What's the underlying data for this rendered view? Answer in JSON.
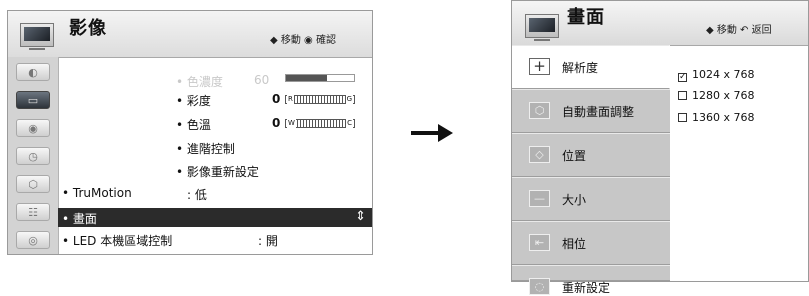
{
  "left_panel": {
    "title": "影像",
    "nav_hint": "◆ 移動 ◉ 確認",
    "sidebar_icons": [
      "picture-icon",
      "screen-icon",
      "audio-icon",
      "time-icon",
      "lock-icon",
      "option-icon",
      "input-icon"
    ],
    "rows": {
      "color_depth": {
        "label": "• 色濃度",
        "value": "60",
        "level": 0.6
      },
      "tint": {
        "label": "• 彩度",
        "value": "0",
        "left": "R",
        "right": "G"
      },
      "color_temp": {
        "label": "• 色溫",
        "value": "0",
        "left": "W",
        "right": "C"
      },
      "advanced": {
        "label": "• 進階控制"
      },
      "reset": {
        "label": "• 影像重新設定"
      },
      "trumotion": {
        "label": "• TruMotion",
        "value": ": 低"
      },
      "screen": {
        "label": "• 畫面",
        "scroll_icon": "⇕"
      },
      "led": {
        "label": "• LED 本機區域控制",
        "value": ": 開"
      }
    }
  },
  "arrow": "right-arrow-icon",
  "right_panel": {
    "title": "畫面",
    "nav_hint": "◆ 移動 ↶ 返回",
    "menu": [
      {
        "label": "解析度",
        "icon": "+"
      },
      {
        "label": "自動畫面調整",
        "icon": "⬡"
      },
      {
        "label": "位置",
        "icon": "◇"
      },
      {
        "label": "大小",
        "icon": "—"
      },
      {
        "label": "相位",
        "icon": "⇤"
      },
      {
        "label": "重新設定",
        "icon": "◌"
      }
    ],
    "resolutions": [
      {
        "label": "1024 x 768",
        "checked": true
      },
      {
        "label": "1280 x 768",
        "checked": false
      },
      {
        "label": "1360 x 768",
        "checked": false
      }
    ]
  }
}
